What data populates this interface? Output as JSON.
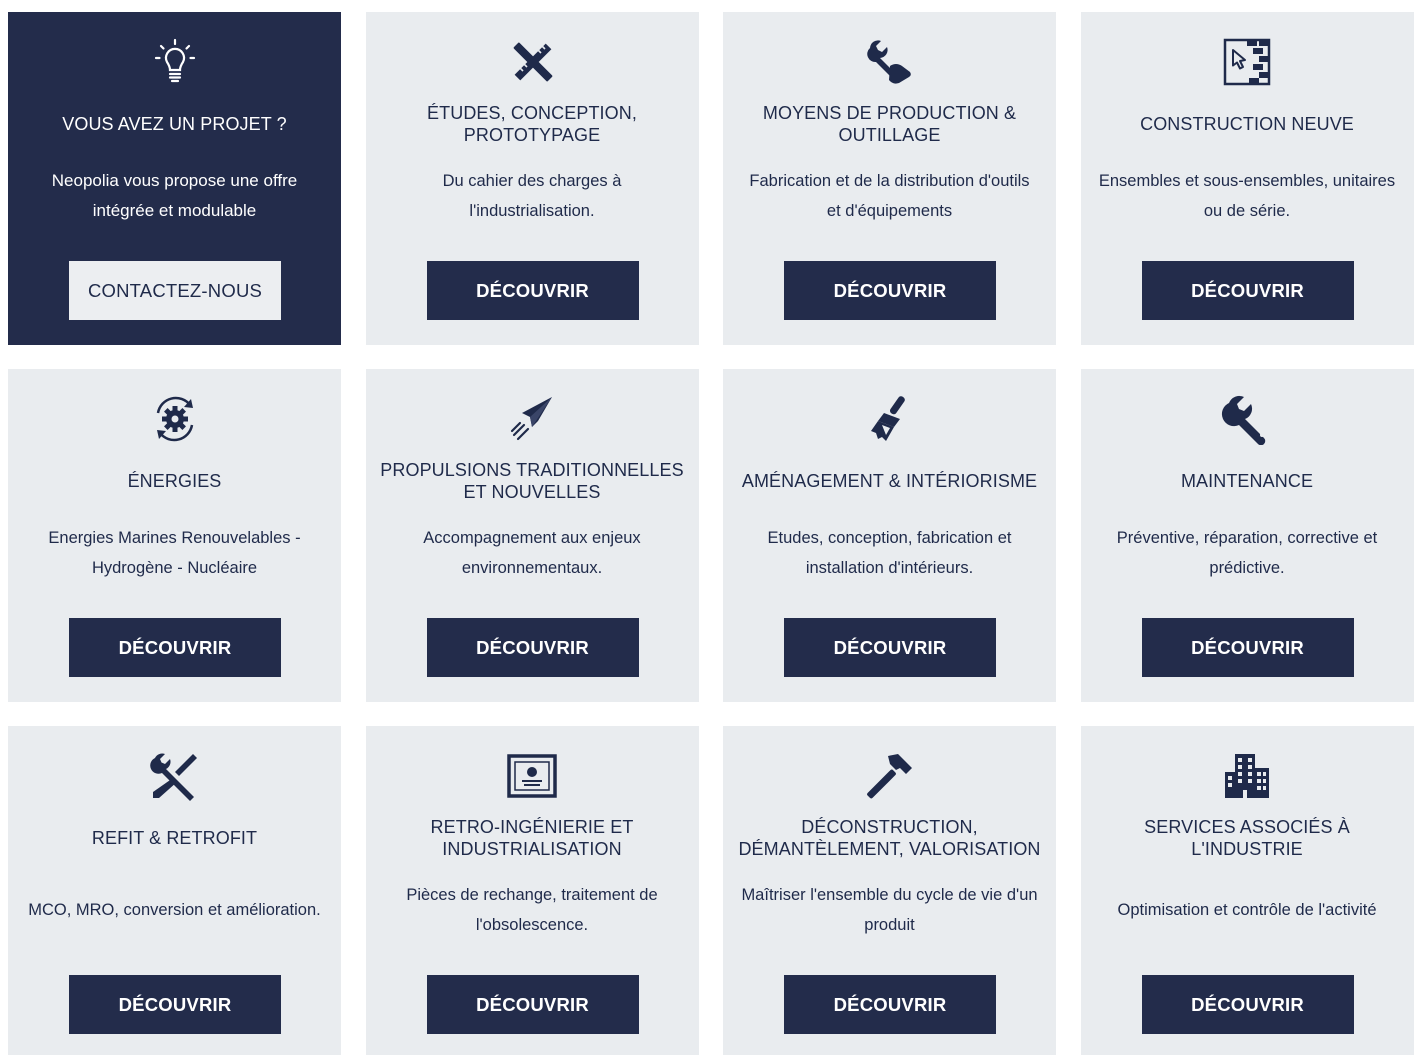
{
  "colors": {
    "navy": "#232c4b",
    "card_bg": "#e9ecef",
    "light_button": "#eceef1"
  },
  "cards": [
    {
      "icon": "lightbulb-icon",
      "title": "VOUS AVEZ UN PROJET ?",
      "description": "Neopolia vous propose une offre intégrée et modulable",
      "button": "CONTACTEZ-NOUS"
    },
    {
      "icon": "ruler-pencil-icon",
      "title": "ÉTUDES, CONCEPTION, PROTOTYPAGE",
      "description": "Du cahier des charges à l'industrialisation.",
      "button": "DÉCOUVRIR"
    },
    {
      "icon": "wrench-hand-icon",
      "title": "MOYENS DE PRODUCTION & OUTILLAGE",
      "description": "Fabrication et de la distribution d'outils et d'équipements",
      "button": "DÉCOUVRIR"
    },
    {
      "icon": "blueprint-icon",
      "title": "CONSTRUCTION NEUVE",
      "description": "Ensembles et sous-ensembles, unitaires ou de série.",
      "button": "DÉCOUVRIR"
    },
    {
      "icon": "gear-cycle-icon",
      "title": "ÉNERGIES",
      "description": "Energies Marines Renouvelables - Hydrogène - Nucléaire",
      "button": "DÉCOUVRIR"
    },
    {
      "icon": "paper-plane-icon",
      "title": "PROPULSIONS TRADITIONNELLES ET NOUVELLES",
      "description": "Accompagnement aux enjeux environnementaux.",
      "button": "DÉCOUVRIR"
    },
    {
      "icon": "paint-brush-icon",
      "title": "AMÉNAGEMENT & INTÉRIORISME",
      "description": "Etudes, conception, fabrication et installation d'intérieurs.",
      "button": "DÉCOUVRIR"
    },
    {
      "icon": "wrench-icon",
      "title": "MAINTENANCE",
      "description": "Préventive, réparation, corrective et prédictive.",
      "button": "DÉCOUVRIR"
    },
    {
      "icon": "tools-crossed-icon",
      "title": "REFIT & RETROFIT",
      "description": "MCO, MRO, conversion et amélioration.",
      "button": "DÉCOUVRIR"
    },
    {
      "icon": "certificate-icon",
      "title": "RETRO-INGÉNIERIE ET INDUSTRIALISATION",
      "description": "Pièces de rechange, traitement de l'obsolescence.",
      "button": "DÉCOUVRIR"
    },
    {
      "icon": "hammer-icon",
      "title": "DÉCONSTRUCTION, DÉMANTÈLEMENT, VALORISATION",
      "description": "Maîtriser l'ensemble du cycle de vie d'un produit",
      "button": "DÉCOUVRIR"
    },
    {
      "icon": "buildings-icon",
      "title": "SERVICES ASSOCIÉS À L'INDUSTRIE",
      "description": "Optimisation et contrôle de l'activité",
      "button": "DÉCOUVRIR"
    }
  ]
}
